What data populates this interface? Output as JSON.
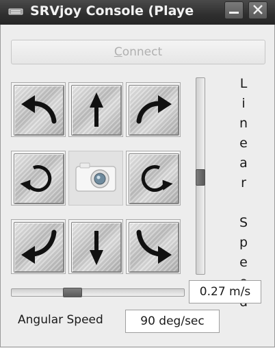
{
  "window": {
    "title": "SRVjoy Console (Playe",
    "app_icon": "window-menu-icon",
    "minimize_icon": "minimize-icon",
    "close_icon": "close-icon"
  },
  "connect_button": {
    "label": "Connect",
    "enabled": false
  },
  "joypad": [
    {
      "name": "forward-left",
      "icon": "curve-up-left-arrow-icon"
    },
    {
      "name": "forward",
      "icon": "up-arrow-icon"
    },
    {
      "name": "forward-right",
      "icon": "curve-up-right-arrow-icon"
    },
    {
      "name": "rotate-left",
      "icon": "rotate-ccw-icon"
    },
    {
      "name": "camera",
      "icon": "camera-icon"
    },
    {
      "name": "rotate-right",
      "icon": "rotate-cw-icon"
    },
    {
      "name": "backward-left",
      "icon": "curve-down-left-arrow-icon"
    },
    {
      "name": "backward",
      "icon": "down-arrow-icon"
    },
    {
      "name": "backward-right",
      "icon": "curve-down-right-arrow-icon"
    }
  ],
  "linear_speed": {
    "label_letters": [
      "L",
      "i",
      "n",
      "e",
      "a",
      "r",
      "",
      "S",
      "p",
      "e",
      "e",
      "d"
    ],
    "value_text": "0.27 m/s",
    "slider_level": 0.5
  },
  "angular_speed": {
    "label": "Angular Speed",
    "value_text": "90 deg/sec",
    "slider_level": 0.35
  },
  "colors": {
    "titlebar": "#2f2f2f",
    "background": "#ededed",
    "slider_thumb": "#5a5a5a"
  }
}
